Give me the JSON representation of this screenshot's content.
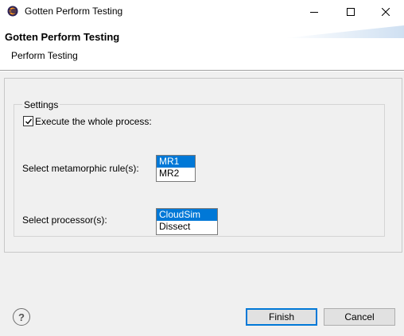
{
  "window": {
    "title": "Gotten Perform Testing"
  },
  "header": {
    "title": "Gotten Perform Testing",
    "subtitle": "Perform Testing"
  },
  "settings": {
    "group_label": "Settings",
    "execute_checkbox": {
      "label": "Execute the whole process:",
      "checked": true
    },
    "rules": {
      "label": "Select metamorphic rule(s):",
      "items": [
        "MR1",
        "MR2"
      ],
      "selected": "MR1"
    },
    "processors": {
      "label": "Select processor(s):",
      "items": [
        "CloudSim",
        "Dissect"
      ],
      "selected": "CloudSim"
    }
  },
  "footer": {
    "help_symbol": "?",
    "finish_label": "Finish",
    "cancel_label": "Cancel"
  },
  "colors": {
    "selection": "#0078d7",
    "default_button_border": "#0078d7",
    "banner_gradient": "#cfe0f2"
  }
}
